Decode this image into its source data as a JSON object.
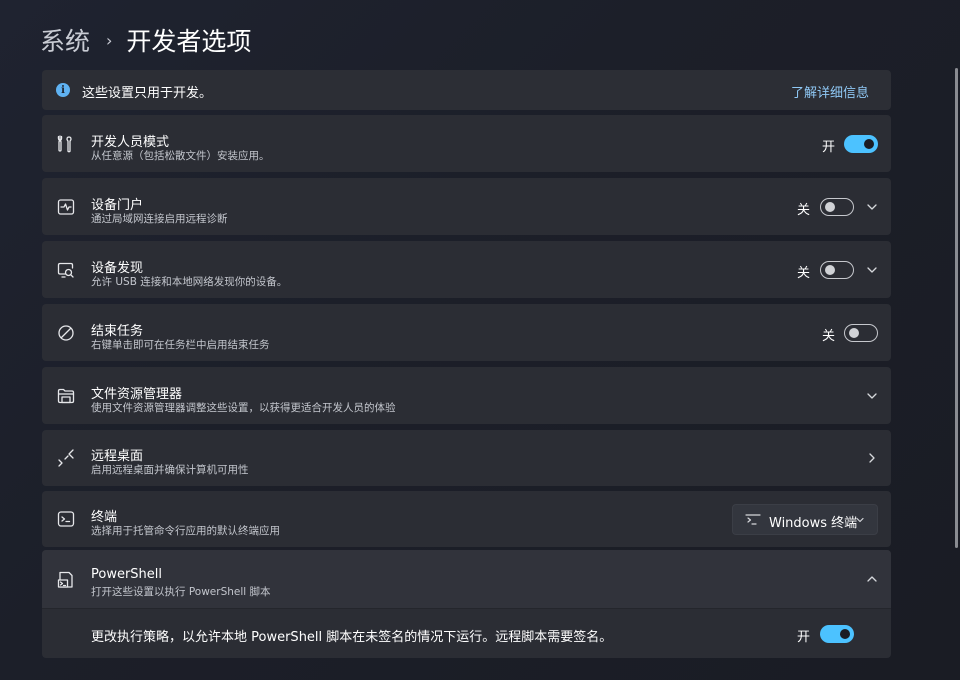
{
  "breadcrumb": {
    "parent": "系统",
    "separator": "›",
    "current": "开发者选项"
  },
  "info": {
    "text": "这些设置只用于开发。",
    "link": "了解详细信息"
  },
  "rows": [
    {
      "icon": "tools-icon",
      "title": "开发人员模式",
      "desc": "从任意源（包括松散文件）安装应用。",
      "state": "开",
      "toggle": "on",
      "control": "toggle"
    },
    {
      "icon": "device-portal-icon",
      "title": "设备门户",
      "desc": "通过局域网连接启用远程诊断",
      "state": "关",
      "toggle": "off",
      "control": "toggle-expand"
    },
    {
      "icon": "device-discovery-icon",
      "title": "设备发现",
      "desc": "允许 USB 连接和本地网络发现你的设备。",
      "state": "关",
      "toggle": "off",
      "control": "toggle-expand"
    },
    {
      "icon": "block-icon",
      "title": "结束任务",
      "desc": "右键单击即可在任务栏中启用结束任务",
      "state": "关",
      "toggle": "off",
      "control": "toggle"
    },
    {
      "icon": "folder-icon",
      "title": "文件资源管理器",
      "desc": "使用文件资源管理器调整这些设置，以获得更适合开发人员的体验",
      "control": "expand"
    },
    {
      "icon": "remote-desktop-icon",
      "title": "远程桌面",
      "desc": "启用远程桌面并确保计算机可用性",
      "control": "navigate"
    },
    {
      "icon": "terminal-icon",
      "title": "终端",
      "desc": "选择用于托管命令行应用的默认终端应用",
      "control": "dropdown",
      "dropdown_value": "Windows 终端"
    }
  ],
  "powershell": {
    "title": "PowerShell",
    "desc": "打开这些设置以执行 PowerShell 脚本",
    "sub_setting": "更改执行策略，以允许本地 PowerShell 脚本在未签名的情况下运行。远程脚本需要签名。",
    "state": "开",
    "toggle": "on"
  },
  "colors": {
    "accent": "#4cc2ff",
    "link": "#8fc8f5",
    "info_icon": "#5fb2f2"
  }
}
